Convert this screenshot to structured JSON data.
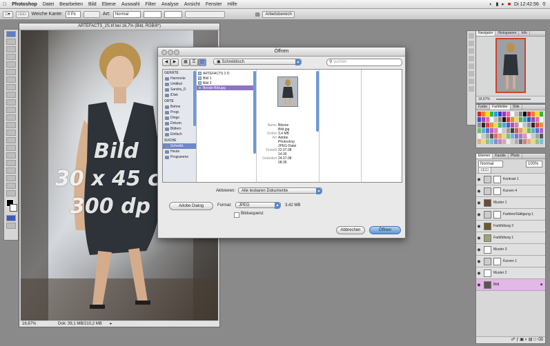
{
  "menubar": {
    "items": [
      "Photoshop",
      "Datei",
      "Bearbeiten",
      "Bild",
      "Ebene",
      "Auswahl",
      "Filter",
      "Analyse",
      "Ansicht",
      "Fenster",
      "Hilfe"
    ],
    "clock": "Di 12:42:56"
  },
  "options_bar": {
    "label_kante": "Weiche Kante:",
    "value_kante": "0 Px",
    "mode_label": "Art:",
    "mode_value": "Normal",
    "workspace_label": "Arbeitsbereich"
  },
  "document": {
    "title": "ARTEFACTS_2S.tif bei 16,7% (Bild, RGB/8*)",
    "zoom": "16,67%",
    "doc_info": "Dok: 39,1 MB/210,2 MB",
    "overlay_line1": "Bild",
    "overlay_line2": "30 x 45 c",
    "overlay_line3": "300 dp"
  },
  "dialog": {
    "title": "Öffnen",
    "location": "Schreibtisch",
    "search_placeholder": "suchen",
    "sidebar": {
      "devices_header": "GERÄTE",
      "devices": [
        "Harmonie",
        "Untitled",
        "Sandra_D",
        "iDisk"
      ],
      "places_header": "ORTE",
      "places": [
        "Bahne",
        "Progr.",
        "Dingo",
        "Dokum.",
        "Bildern",
        "Einfach"
      ],
      "search_header": "SUCHE",
      "search": [
        "Schreibt.",
        "Heute",
        "Programme"
      ]
    },
    "files": [
      "ARTEFACTS 2 D",
      "Bild 1",
      "Bild 2",
      "Berate-Bild.jpg"
    ],
    "preview": {
      "rows": [
        {
          "k": "Name",
          "v": "Bikone"
        },
        {
          "k": "",
          "v": "Bild.jpg"
        },
        {
          "k": "Größe",
          "v": "3,4 MB"
        },
        {
          "k": "Art",
          "v": "Adobe"
        },
        {
          "k": "",
          "v": "Photoshop"
        },
        {
          "k": "",
          "v": "JPEG-Datei"
        },
        {
          "k": "Erstellt",
          "v": "22.07.08"
        },
        {
          "k": "",
          "v": "14:30"
        },
        {
          "k": "Geändert",
          "v": "24.07.08"
        },
        {
          "k": "",
          "v": "08:35"
        }
      ]
    },
    "enable_label": "Aktivieren:",
    "enable_value": "Alle lesbaren Dokumente",
    "format_label": "Format:",
    "format_value": "JPEG",
    "file_size": "3,42 MB",
    "adobe_dialog": "Adobe Dialog",
    "image_sequence": "Bildsequenz",
    "cancel": "Abbrechen",
    "open": "Öffnen"
  },
  "navigator": {
    "tabs": [
      "Navigator",
      "Histogramm",
      "Info"
    ],
    "zoom": "16,67%"
  },
  "swatches": {
    "tabs": [
      "Farbe",
      "Farbfelder",
      "Stile"
    ]
  },
  "layers": {
    "tabs": [
      "Ebenen",
      "Kanäle",
      "Pfade"
    ],
    "mode": "Normal",
    "opacity": "100%",
    "rows": [
      {
        "name": "Kontrast 1",
        "selected": false
      },
      {
        "name": "Kurven 4",
        "selected": false
      },
      {
        "name": "Muster 1",
        "selected": false
      },
      {
        "name": "Farbton/Sättigung 1",
        "selected": false
      },
      {
        "name": "Farbfüllung 2",
        "selected": false
      },
      {
        "name": "Farbfüllung 1",
        "selected": false
      },
      {
        "name": "Muster 3",
        "selected": false
      },
      {
        "name": "Kurven 1",
        "selected": false
      },
      {
        "name": "Muster 2",
        "selected": false
      },
      {
        "name": "Bild",
        "selected": true
      }
    ]
  },
  "colors": {
    "selection_purple": "#8b74c4",
    "layer_selected": "#e3b7e7",
    "accent_blue": "#5c93d6"
  }
}
